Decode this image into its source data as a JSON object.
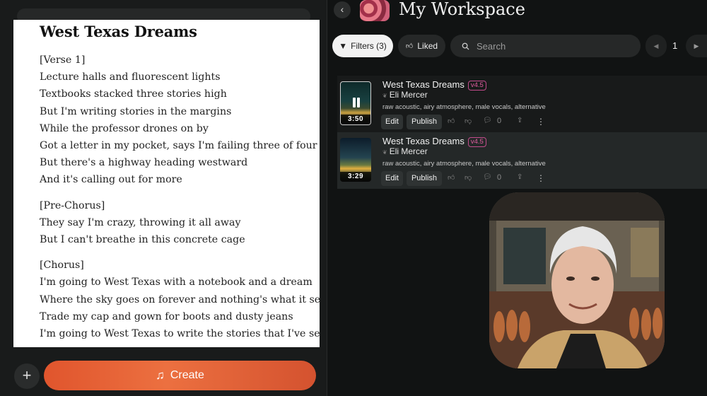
{
  "lyrics": {
    "title": "West Texas Dreams",
    "sections": [
      {
        "lines": [
          "[Verse 1]",
          "Lecture halls and fluorescent lights",
          "Textbooks stacked three stories high",
          "But I'm writing stories in the margins",
          "While the professor drones on by",
          "Got a letter in my pocket, says I'm failing three of four",
          "But there's a highway heading westward",
          "And it's calling out for more"
        ]
      },
      {
        "lines": [
          "[Pre-Chorus]",
          "They say I'm crazy, throwing it all away",
          "But I can't breathe in this concrete cage"
        ]
      },
      {
        "lines": [
          "[Chorus]",
          "I'm going to West Texas with a notebook and a dream",
          "Where the sky goes on forever and nothing's what it seems",
          "Trade my cap and gown for boots and dusty jeans",
          "I'm going to West Texas to write the stories that I've seen"
        ]
      }
    ]
  },
  "bottom": {
    "plus_label": "+",
    "create_label": "Create"
  },
  "workspace": {
    "title": "My Workspace",
    "filters_label": "Filters (3)",
    "liked_label": "Liked",
    "search_placeholder": "Search",
    "page": "1"
  },
  "songs": [
    {
      "title": "West Texas Dreams",
      "version": "v4.5",
      "artist": "Eli Mercer",
      "tags": "raw acoustic, airy atmosphere, male vocals, alternative",
      "duration": "3:50",
      "comments": "0",
      "edit_label": "Edit",
      "publish_label": "Publish",
      "playing": true
    },
    {
      "title": "West Texas Dreams",
      "version": "v4.5",
      "artist": "Eli Mercer",
      "tags": "raw acoustic, airy atmosphere, male vocals, alternative",
      "duration": "3:29",
      "comments": "0",
      "edit_label": "Edit",
      "publish_label": "Publish",
      "playing": false
    }
  ],
  "colors": {
    "create_gradient_start": "#e0552d",
    "create_gradient_end": "#d4522f",
    "version_badge": "#e25ca0",
    "background": "#111313"
  },
  "icons": {
    "back": "chevron-left-icon",
    "filter": "filter-icon",
    "liked": "thumbs-up-icon",
    "search": "search-icon",
    "create": "music-note-sparkle-icon"
  }
}
